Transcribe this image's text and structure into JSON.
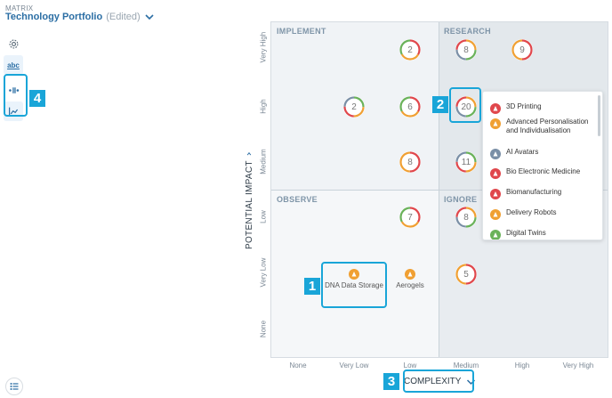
{
  "header": {
    "app_label": "MATRIX",
    "title": "Technology Portfolio",
    "status": "(Edited)"
  },
  "toolbar": {
    "label_toggle": "abc"
  },
  "quadrants": {
    "top_left": "IMPLEMENT",
    "top_right": "RESEARCH",
    "bottom_left": "OBSERVE",
    "bottom_right": "IGNORE"
  },
  "axes": {
    "y_title": "POTENTIAL IMPACT",
    "x_title": "COMPLEXITY",
    "y_ticks": [
      "Very High",
      "High",
      "Medium",
      "Low",
      "Very Low",
      "None"
    ],
    "x_ticks": [
      "None",
      "Very Low",
      "Low",
      "Medium",
      "High",
      "Very High"
    ]
  },
  "bubbles": [
    {
      "count": "2",
      "x": "Low",
      "y": "Very High"
    },
    {
      "count": "8",
      "x": "Medium",
      "y": "Very High"
    },
    {
      "count": "9",
      "x": "High",
      "y": "Very High"
    },
    {
      "count": "2",
      "x": "Very Low",
      "y": "High"
    },
    {
      "count": "6",
      "x": "Low",
      "y": "High"
    },
    {
      "count": "20",
      "x": "Medium",
      "y": "High"
    },
    {
      "count": "8",
      "x": "Low",
      "y": "Medium"
    },
    {
      "count": "11",
      "x": "Medium",
      "y": "Medium"
    },
    {
      "count": "7",
      "x": "Low",
      "y": "Low"
    },
    {
      "count": "8",
      "x": "Medium",
      "y": "Low"
    },
    {
      "count": "5",
      "x": "Medium",
      "y": "Very Low"
    }
  ],
  "technologies": [
    {
      "name": "DNA Data Storage",
      "color": "#f0a033"
    },
    {
      "name": "Aerogels",
      "color": "#f0a033"
    }
  ],
  "popup": {
    "items": [
      {
        "name": "3D Printing",
        "color": "#e0474c"
      },
      {
        "name": "Advanced Personalisation and Individualisation",
        "color": "#f0a033"
      },
      {
        "name": "AI Avatars",
        "color": "#7a8fa6"
      },
      {
        "name": "Bio Electronic Medicine",
        "color": "#e0474c"
      },
      {
        "name": "Biomanufacturing",
        "color": "#e0474c"
      },
      {
        "name": "Delivery Robots",
        "color": "#f0a033"
      },
      {
        "name": "Digital Twins",
        "color": "#6ab25a"
      }
    ]
  },
  "callouts": {
    "one": "1",
    "two": "2",
    "three": "3",
    "four": "4"
  },
  "colors": {
    "accent": "#19a5d8",
    "brand": "#2b6ea4",
    "red": "#e0474c",
    "orange": "#f0a033",
    "green": "#6ab25a",
    "grey": "#7a8fa6"
  }
}
